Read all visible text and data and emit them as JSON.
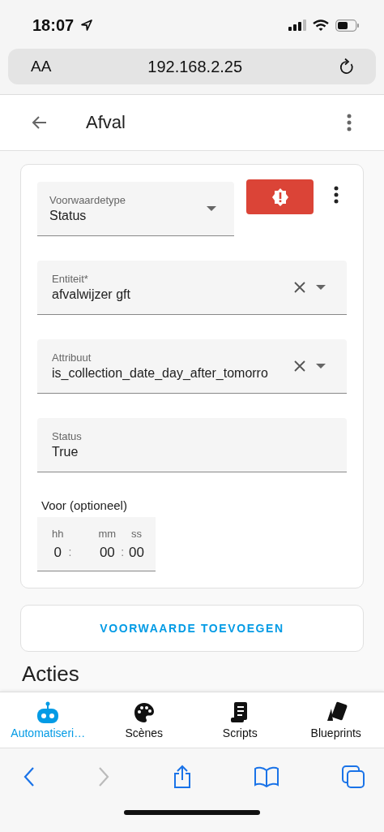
{
  "status_bar": {
    "time": "18:07"
  },
  "browser": {
    "text_size": "AA",
    "url": "192.168.2.25"
  },
  "header": {
    "title": "Afval"
  },
  "condition_card": {
    "type_field": {
      "label": "Voorwaardetype",
      "value": "Status"
    },
    "fields": [
      {
        "kind": "select",
        "label": "Entiteit*",
        "value": "afvalwijzer gft",
        "clearable": true
      },
      {
        "kind": "select",
        "label": "Attribuut",
        "value": "is_collection_date_day_after_tomorro",
        "clearable": true
      },
      {
        "kind": "text",
        "label": "Status",
        "value": "True",
        "clearable": false
      }
    ],
    "duration": {
      "label": "Voor (optioneel)",
      "parts": [
        {
          "unit": "hh",
          "value": "0"
        },
        {
          "unit": "mm",
          "value": "00"
        },
        {
          "unit": "ss",
          "value": "00"
        }
      ],
      "separator": ":"
    }
  },
  "add_button": "VOORWAARDE TOEVOEGEN",
  "section_heading": "Acties",
  "tabs": [
    {
      "label": "Automatiseri…",
      "kind": "robot",
      "selected": true
    },
    {
      "label": "Scènes",
      "kind": "palette",
      "selected": false
    },
    {
      "label": "Scripts",
      "kind": "script",
      "selected": false
    },
    {
      "label": "Blueprints",
      "kind": "cards",
      "selected": false
    }
  ]
}
